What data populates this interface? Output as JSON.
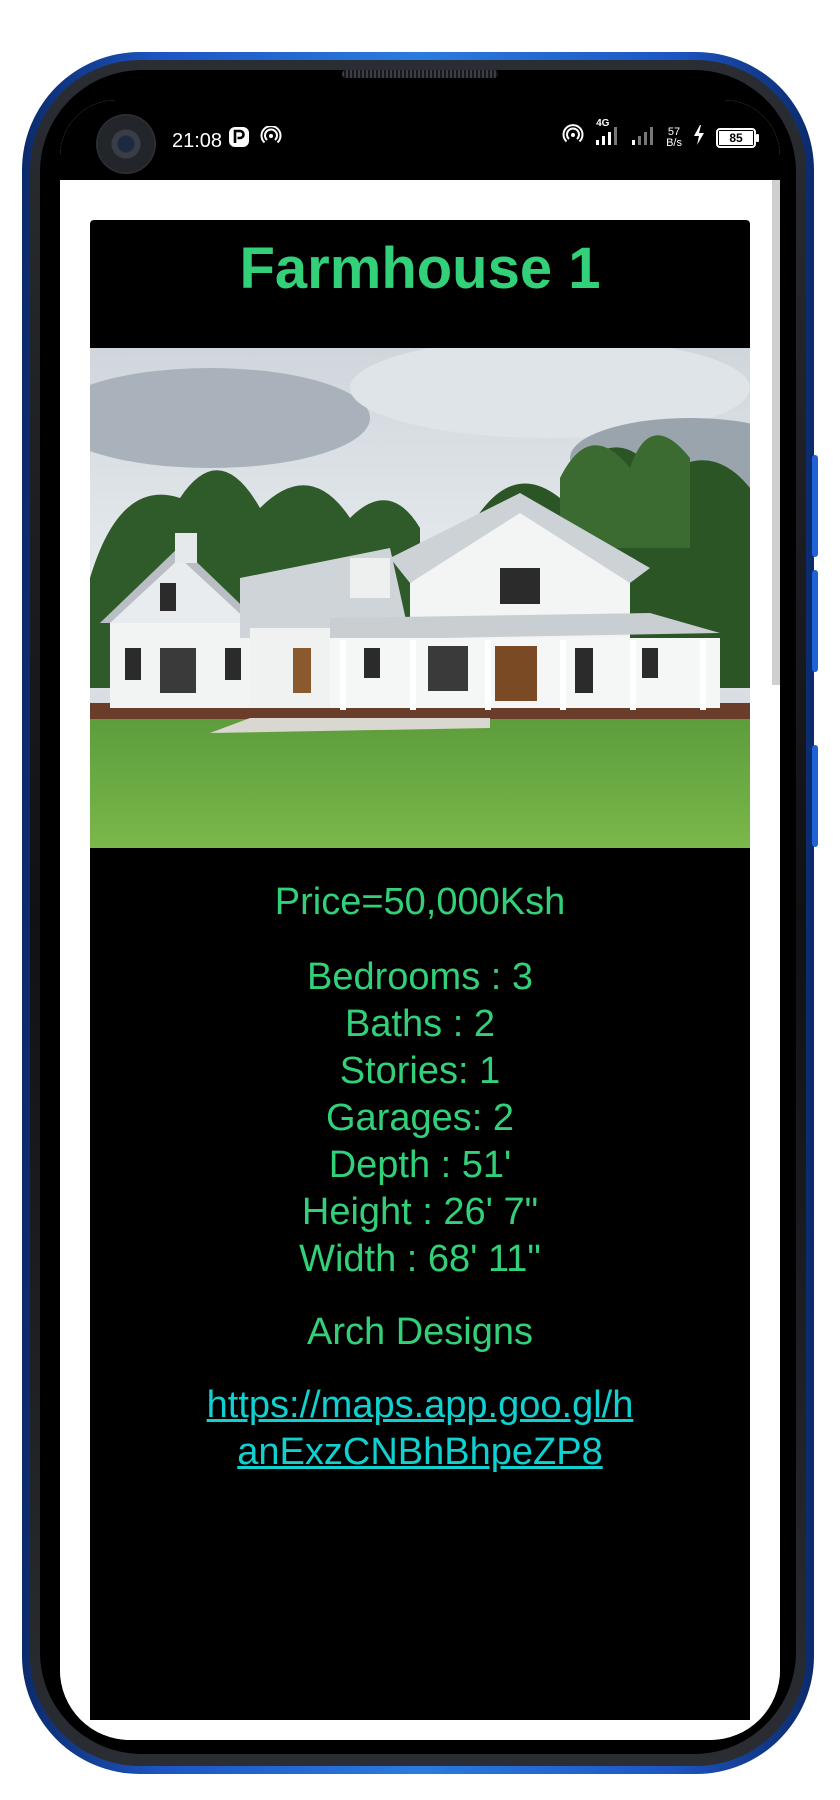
{
  "status_bar": {
    "time": "21:08",
    "left_icons": [
      "parking-icon",
      "hotspot-icon"
    ],
    "network": "4G",
    "speed_value": "57",
    "speed_unit": "B/s",
    "battery": "85"
  },
  "listing": {
    "title": "Farmhouse 1",
    "image_alt": "White farmhouse with wraparound porch and green lawn",
    "price": "Price=50,000Ksh",
    "specs": [
      "Bedrooms : 3",
      "Baths : 2",
      "Stories: 1",
      "Garages: 2",
      "Depth : 51'",
      "Height : 26' 7\"",
      "Width : 68' 11\""
    ],
    "company": "Arch Designs",
    "map_link": "https://maps.app.goo.gl/hanExzCNBhBhpeZP8"
  },
  "colors": {
    "text_green": "#33d07a",
    "link_cyan": "#10d0d0",
    "card_bg": "#000000",
    "frame_blue": "#1d56c4"
  }
}
